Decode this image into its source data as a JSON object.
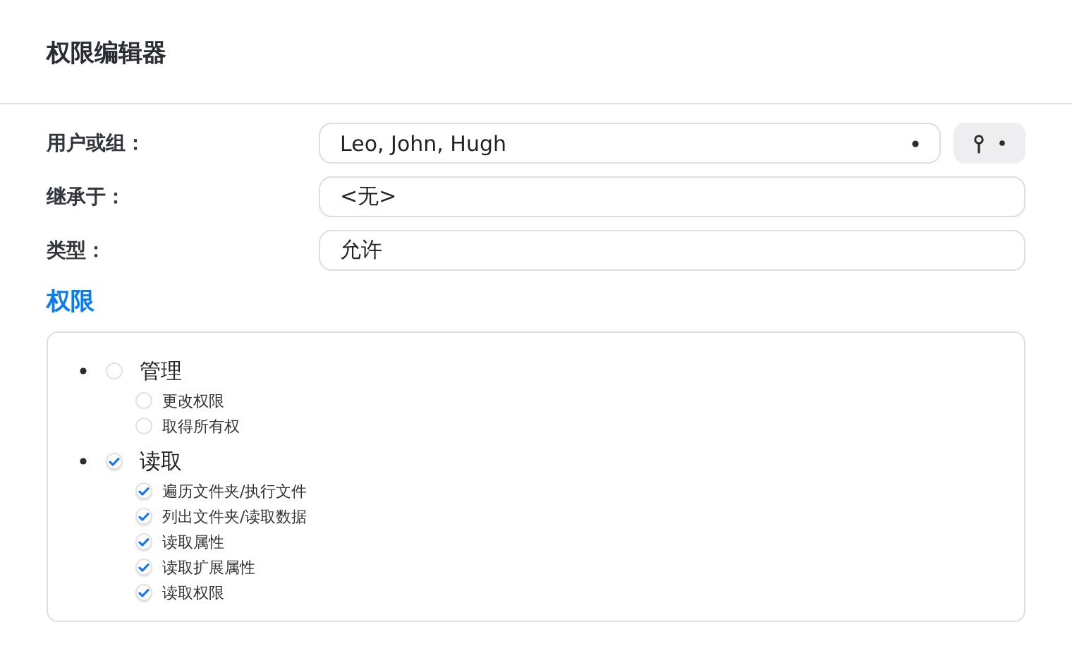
{
  "window": {
    "title": "权限编辑器"
  },
  "fields": [
    {
      "label": "用户或组：",
      "value": "Leo, John, Hugh",
      "kind": "picker"
    },
    {
      "label": "继承于：",
      "value": "<无>",
      "kind": "text"
    },
    {
      "label": "类型：",
      "value": "允许",
      "kind": "text"
    }
  ],
  "permissions": {
    "heading": "权限",
    "items": [
      {
        "label": "管理",
        "checked": false,
        "children": [
          {
            "label": "更改权限",
            "checked": false
          },
          {
            "label": "取得所有权",
            "checked": false
          }
        ]
      },
      {
        "label": "读取",
        "checked": true,
        "children": [
          {
            "label": "遍历文件夹/执行文件",
            "checked": true
          },
          {
            "label": "列出文件夹/读取数据",
            "checked": true
          },
          {
            "label": "读取属性",
            "checked": true
          },
          {
            "label": "读取扩展属性",
            "checked": true
          },
          {
            "label": "读取权限",
            "checked": true
          }
        ]
      }
    ]
  }
}
